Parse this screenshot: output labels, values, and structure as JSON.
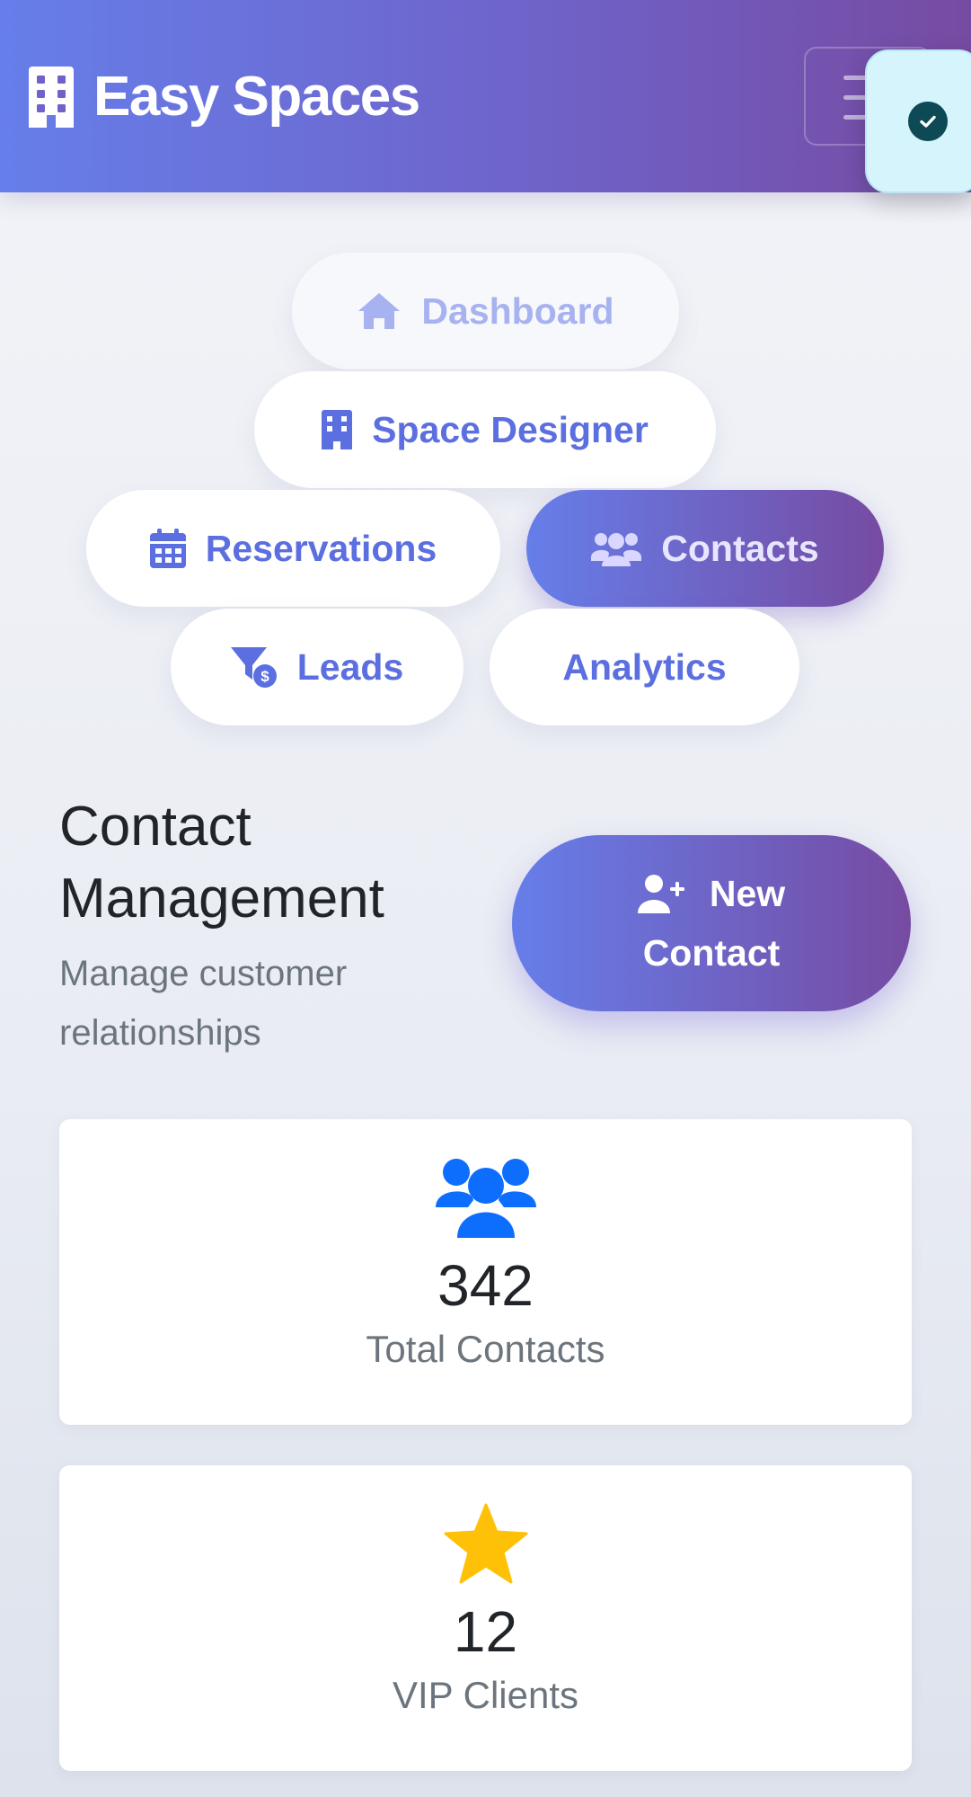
{
  "app": {
    "title": "Easy Spaces"
  },
  "header": {
    "menu_icon": "hamburger-icon",
    "toast_icon": "check-circle-icon"
  },
  "nav": {
    "items": [
      {
        "label": "Dashboard",
        "icon": "home-icon",
        "state": "faded"
      },
      {
        "label": "Space Designer",
        "icon": "building-icon"
      },
      {
        "label": "Reservations",
        "icon": "calendar-icon"
      },
      {
        "label": "Contacts",
        "icon": "users-icon",
        "state": "active"
      },
      {
        "label": "Leads",
        "icon": "funnel-dollar-icon"
      },
      {
        "label": "Analytics",
        "icon": ""
      }
    ]
  },
  "section": {
    "title": "Contact Management",
    "subtitle": "Manage customer relationships",
    "new_button_line1": "New",
    "new_button_line2": "Contact"
  },
  "stats": [
    {
      "value": "342",
      "label": "Total Contacts",
      "icon": "users-icon",
      "color": "#0d6efd"
    },
    {
      "value": "12",
      "label": "VIP Clients",
      "icon": "star-icon",
      "color": "#ffc107"
    }
  ],
  "colors": {
    "accent_start": "#667eea",
    "accent_end": "#764ba2",
    "pill_text": "#5b6fe0"
  }
}
